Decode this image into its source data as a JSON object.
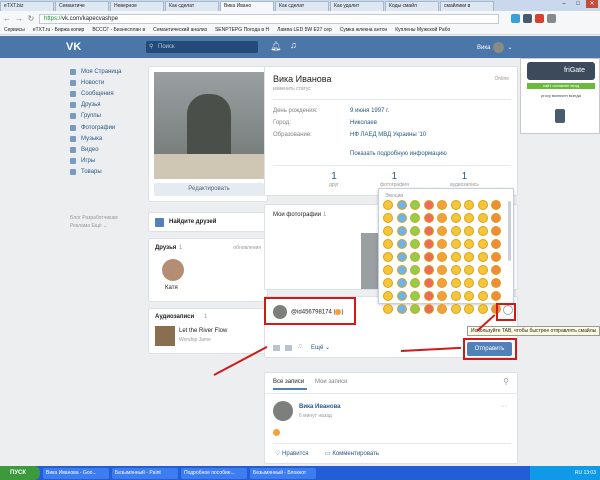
{
  "browser": {
    "tabs": [
      "eTXT.biz",
      "Семантиче",
      "Неверное",
      "Как сделат",
      "Вика Ивано",
      "Как сделат",
      "Как удалит",
      "Коды смайл",
      "смайлики в"
    ],
    "active_tab": 4,
    "url_protocol": "https://",
    "url_rest": "vk.com/kapecvashpe",
    "bookmarks": [
      "Сервисы",
      "eTXT.ru - Биржа копир",
      "ВСССГ - Бизнесплан в",
      "Семантический анализ",
      "SENPTEPG Погода в Н",
      "Лампа LED 5W E27 сер",
      "Сумка жлекна антон",
      "Куплены Мужской Рабо"
    ]
  },
  "header": {
    "logo": "VK",
    "search_placeholder": "Поиск",
    "user_name": "Вика"
  },
  "sidebar": {
    "items": [
      {
        "label": "Моя Страница",
        "icon": "home-icon"
      },
      {
        "label": "Новости",
        "icon": "news-icon"
      },
      {
        "label": "Сообщения",
        "icon": "messages-icon"
      },
      {
        "label": "Друзья",
        "icon": "friends-icon"
      },
      {
        "label": "Группы",
        "icon": "groups-icon"
      },
      {
        "label": "Фотографии",
        "icon": "photos-icon"
      },
      {
        "label": "Музыка",
        "icon": "music-icon"
      },
      {
        "label": "Видео",
        "icon": "video-icon"
      },
      {
        "label": "Игры",
        "icon": "games-icon"
      },
      {
        "label": "Товары",
        "icon": "market-icon"
      }
    ],
    "footer_line1": "Блог  Разработчикам",
    "footer_line2": "Реклама  Ещё ⌄"
  },
  "profile": {
    "edit_button": "Редактировать",
    "find_friends": "Найдите друзей",
    "friends_title": "Друзья",
    "friends_count": "1",
    "friends_updates": "обновления",
    "friend_name": "Катя",
    "audio_title": "Аудиозаписи",
    "audio_count": "1",
    "track_title": "Let the River Flow",
    "track_artist": "Worship Jame",
    "name": "Вика Иванова",
    "status": "изменить статус",
    "online": "Online",
    "birthday_label": "День рождения:",
    "birthday_value": "9 июня 1997 г.",
    "city_label": "Город:",
    "city_value": "Николаев",
    "education_label": "Образование:",
    "education_value": "НФ ЛАЕД МВД Украины '10",
    "show_more": "Показать подробную информацию",
    "counters": [
      {
        "num": "1",
        "label": "друг"
      },
      {
        "num": "1",
        "label": "фотография"
      },
      {
        "num": "1",
        "label": "аудиозапись"
      }
    ],
    "photos_title": "Мои фотографии",
    "photos_count": "1"
  },
  "composer": {
    "text": "@id456798174 (",
    "more": "Ещё ⌄",
    "send": "Отправить",
    "tooltip": "Используйте TAB, чтобы быстрее отправлять смайлы"
  },
  "emoji_panel": {
    "title": "Эмоции",
    "rows": 9,
    "cols": 9
  },
  "wall": {
    "tab_all": "Все записи",
    "tab_mine": "Мои записи",
    "author": "Вика Иванова",
    "time": "6 минут назад",
    "like": "Нравится",
    "comment": "Комментировать"
  },
  "frigate": {
    "name": "friGate",
    "line1": "сайт оставлен вход",
    "line2": "proxy включен всегда"
  },
  "taskbar": {
    "start": "ПУСК",
    "items": [
      "Вика Иванова - Goo...",
      "Безымянный - Paint",
      "Подробное пособие...",
      "Безымянный - Блокнот"
    ],
    "time": "13:03",
    "lang": "RU"
  },
  "colors": {
    "vk_blue": "#4a76a8",
    "link": "#2a5885",
    "annotation_red": "#d1191a"
  }
}
